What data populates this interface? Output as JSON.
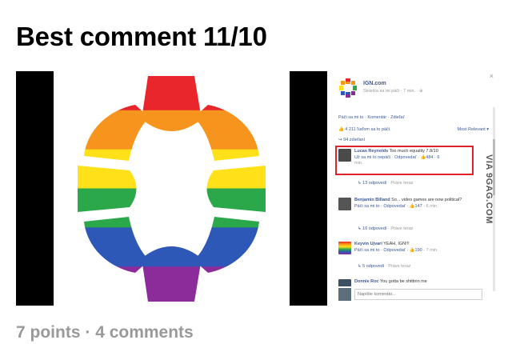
{
  "post": {
    "title": "Best comment 11/10",
    "points": "7 points",
    "separator": " · ",
    "comments": "4 comments"
  },
  "colors": {
    "rainbow": [
      "#e8262c",
      "#f7941d",
      "#ffe11a",
      "#2aa84a",
      "#2d58b8",
      "#8b2c9a"
    ],
    "fb_link": "#3b5998",
    "highlight": "#e0222a"
  },
  "fb": {
    "close_icon": "×",
    "page_name": "IGN.com",
    "page_meta": "Stránka sa mi páči · 7 min. · ⊕",
    "actions": "Páči sa mi to · Komentár · Zdieľať",
    "likes": "4 211 ľuďom sa to páči.",
    "sort": "Most Relevant ▾",
    "shares": "94 zdieľaní",
    "comments": [
      {
        "author": "Lucas Reynolds",
        "text": "Too much equality 7.8/10",
        "meta": "Už sa mi to nepáči · Odpovedať · 👍484 · 6",
        "meta_time": "min.",
        "replies": "13 odpovedí",
        "replies_time": "· Práve teraz"
      },
      {
        "author": "Benjamin Billand",
        "text": "So... video games are now political?",
        "meta": "Páči sa mi to · Odpovedať · 👍147 ·",
        "meta_time": "6 min.",
        "replies": "16 odpovedí",
        "replies_time": "· Práve teraz"
      },
      {
        "author": "Keyvin Ujvari",
        "text": "YEAH, IGN!!!",
        "meta": "Páči sa mi to · Odpovedať · 👍190 ·",
        "meta_time": "7 min.",
        "replies": "5 odpovedí",
        "replies_time": "· Práve teraz"
      },
      {
        "author": "Donnie Roc",
        "text": "You gotta be shittinn me",
        "meta": "",
        "meta_time": "",
        "replies": "",
        "replies_time": ""
      }
    ],
    "reply_placeholder": "Napíšte komentár..."
  },
  "watermark": "VIA 9GAG.COM"
}
